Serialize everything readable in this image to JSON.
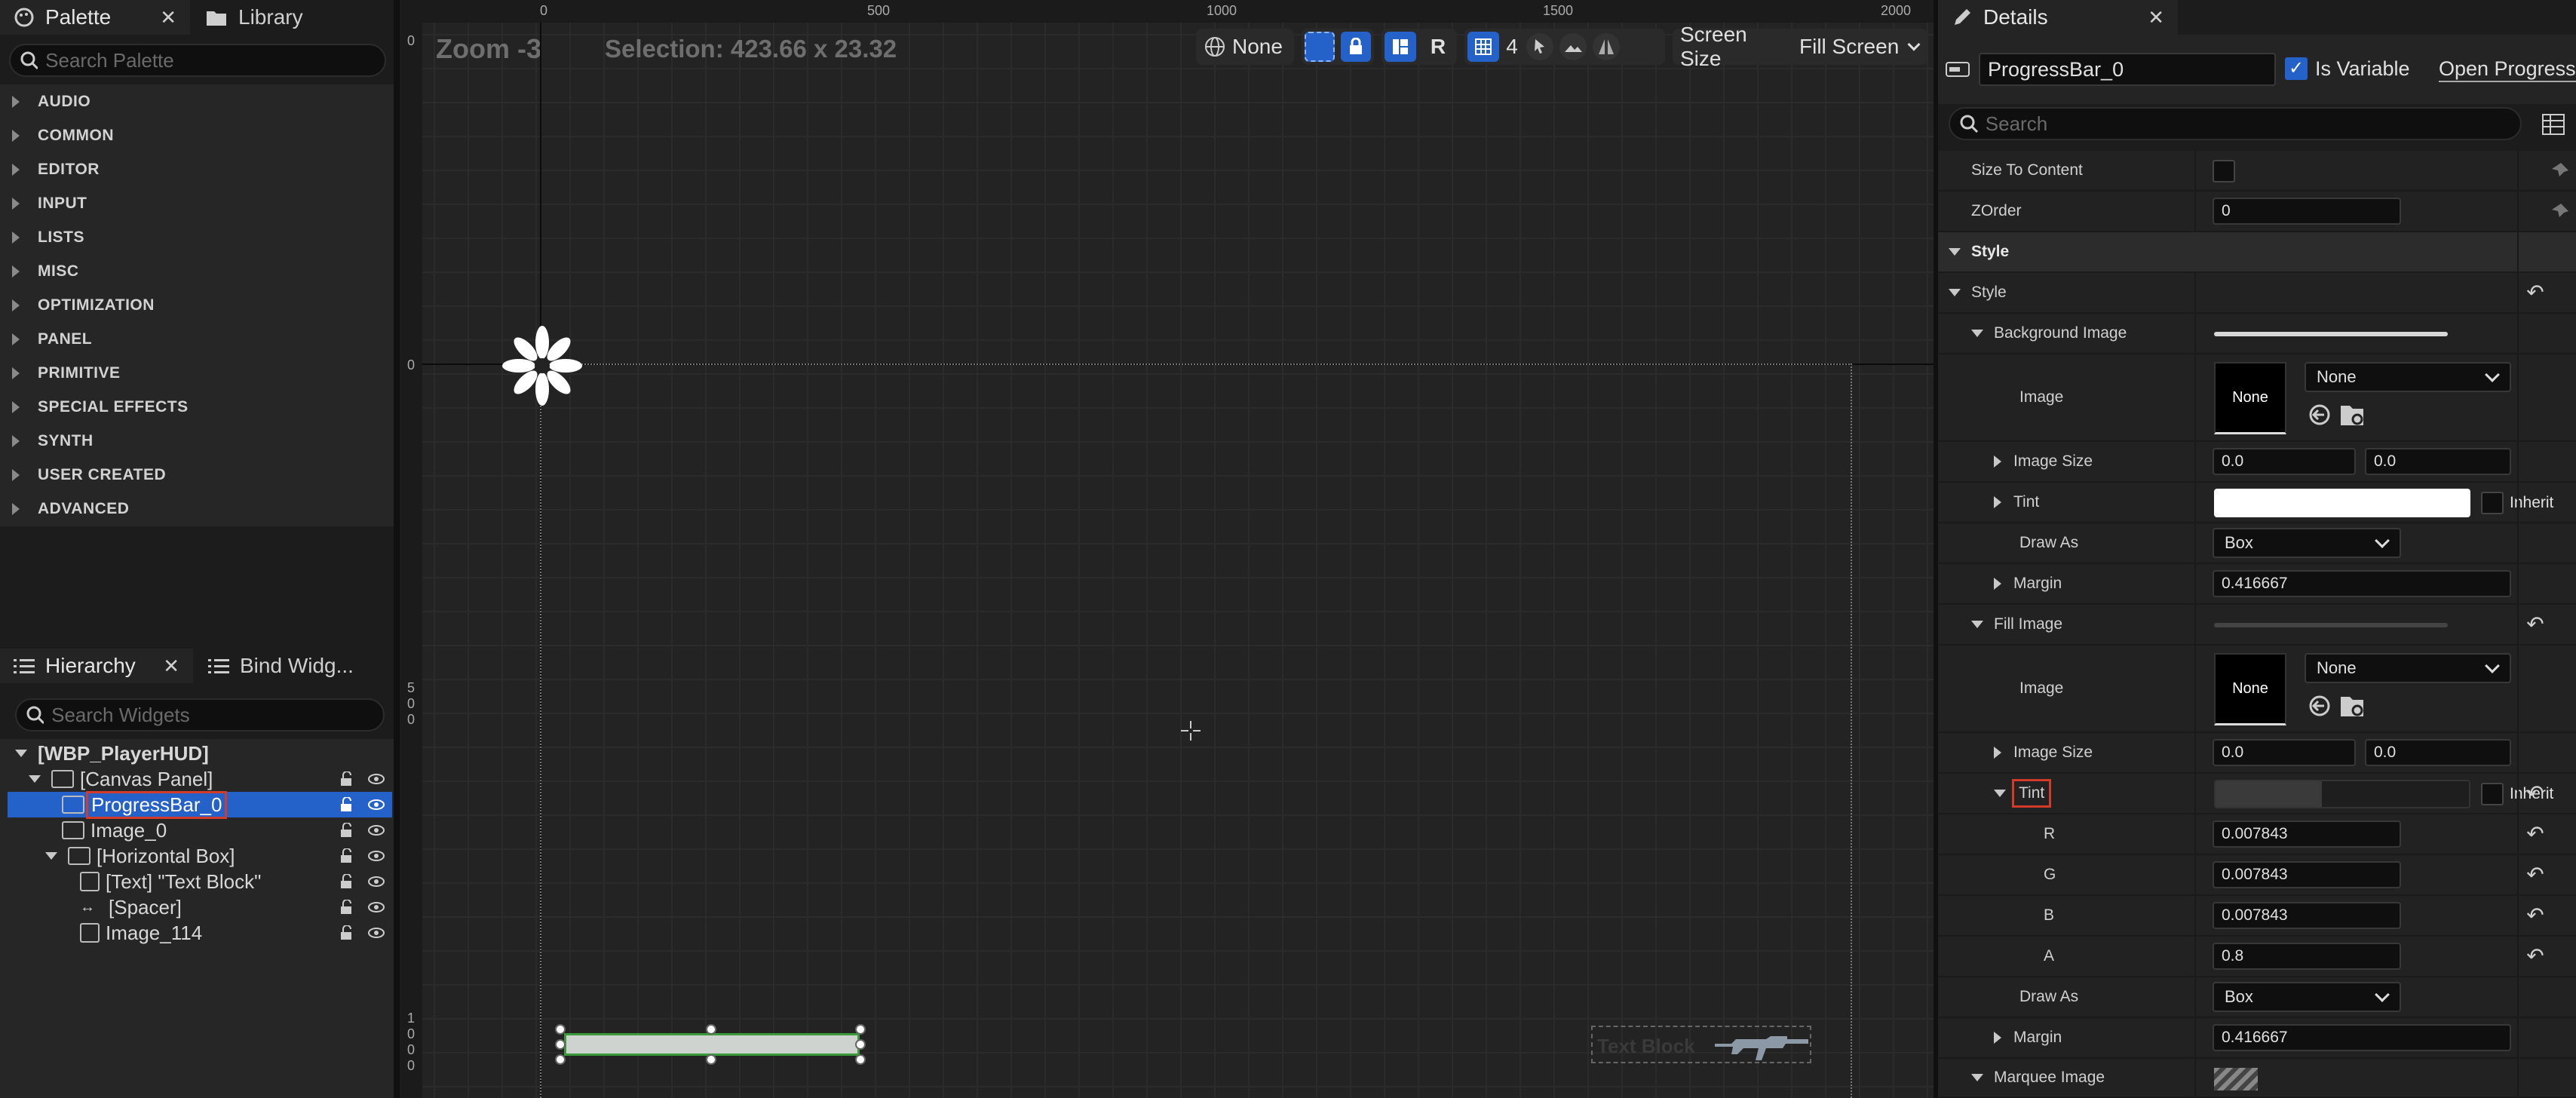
{
  "palette": {
    "tab_label": "Palette",
    "library_label": "Library",
    "search_placeholder": "Search Palette",
    "categories": [
      "AUDIO",
      "COMMON",
      "EDITOR",
      "INPUT",
      "LISTS",
      "MISC",
      "OPTIMIZATION",
      "PANEL",
      "PRIMITIVE",
      "SPECIAL EFFECTS",
      "SYNTH",
      "USER CREATED",
      "ADVANCED"
    ]
  },
  "hierarchy": {
    "tab_label": "Hierarchy",
    "bind_tab_label": "Bind Widg...",
    "search_placeholder": "Search Widgets",
    "root": "[WBP_PlayerHUD]",
    "items": [
      {
        "label": "[Canvas Panel]"
      },
      {
        "label": "ProgressBar_0"
      },
      {
        "label": "Image_0"
      },
      {
        "label": "[Horizontal Box]"
      },
      {
        "label": "[Text] \"Text Block\""
      },
      {
        "label": "[Spacer]"
      },
      {
        "label": "Image_114"
      }
    ]
  },
  "viewport": {
    "zoom": "Zoom -3",
    "selection": "Selection: 423.66 x 23.32",
    "none_label": "None",
    "r_label": "R",
    "grid_value": "4",
    "screen_size": "Screen Size",
    "fill_screen": "Fill Screen",
    "ruler_top": [
      "0",
      "500",
      "1000",
      "1500",
      "2000"
    ],
    "ruler_left_top": "0",
    "ruler_left_mid": "0",
    "ruler_left_500": [
      "5",
      "0",
      "0"
    ],
    "ruler_left_1000": [
      "1",
      "0",
      "0",
      "0"
    ],
    "text_block": "Text Block"
  },
  "details": {
    "tab_label": "Details",
    "widget_name": "ProgressBar_0",
    "is_variable": "Is Variable",
    "open_button": "Open Progress",
    "search_placeholder": "Search",
    "size_to_content": "Size To Content",
    "zorder_label": "ZOrder",
    "zorder_value": "0",
    "style_section": "Style",
    "style_sub": "Style",
    "bg_image": "Background Image",
    "image_label": "Image",
    "none": "None",
    "image_size": "Image Size",
    "size_x": "0.0",
    "size_y": "0.0",
    "tint": "Tint",
    "inherit": "Inherit",
    "draw_as": "Draw As",
    "draw_as_value": "Box",
    "margin": "Margin",
    "margin_value": "0.416667",
    "fill_image": "Fill Image",
    "fill_size_x": "0.0",
    "fill_size_y": "0.0",
    "r_label": "R",
    "r_value": "0.007843",
    "g_label": "G",
    "g_value": "0.007843",
    "b_label": "B",
    "b_value": "0.007843",
    "a_label": "A",
    "a_value": "0.8",
    "fill_draw_as_value": "Box",
    "fill_margin_value": "0.416667",
    "marquee_image": "Marquee Image"
  },
  "colors": {
    "accent": "#2461c8",
    "highlight": "#d23a2a",
    "selection_green": "#3a9a3a"
  }
}
